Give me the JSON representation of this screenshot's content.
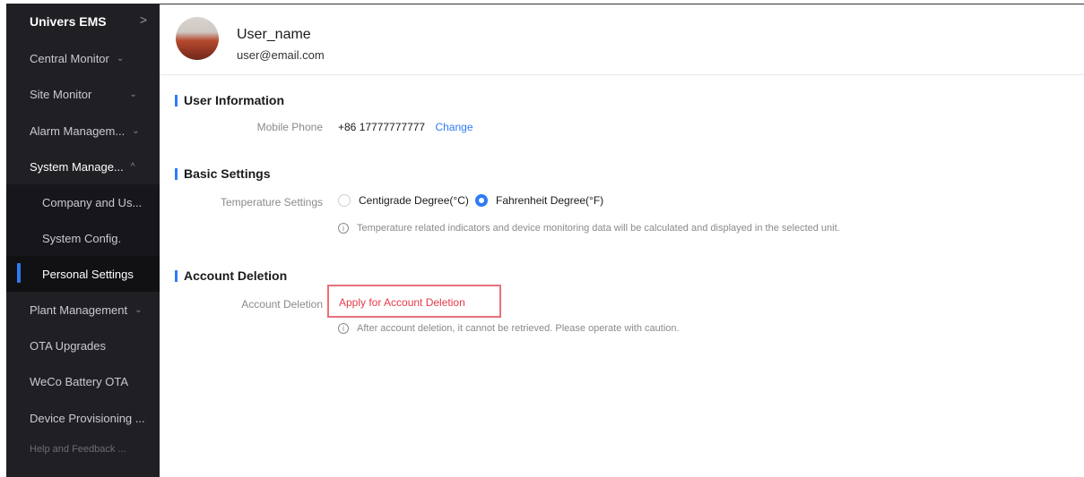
{
  "sidebar": {
    "brand": "Univers EMS",
    "items": [
      {
        "label": "Central Monitor",
        "chevron": "⌄"
      },
      {
        "label": "Site Monitor",
        "chevron": "⌄"
      },
      {
        "label": "Alarm Managem...",
        "chevron": "⌄"
      },
      {
        "label": "System Manage...",
        "chevron": "^"
      },
      {
        "label": "Company and Us..."
      },
      {
        "label": "System Config."
      },
      {
        "label": "Personal Settings"
      },
      {
        "label": "Plant Management",
        "chevron": "⌄"
      },
      {
        "label": "OTA Upgrades"
      },
      {
        "label": "WeCo Battery OTA"
      },
      {
        "label": "Device Provisioning ..."
      },
      {
        "label": "Help and Feedback ..."
      }
    ]
  },
  "user": {
    "name": "User_name",
    "email": "user@email.com"
  },
  "user_info": {
    "title": "User Information",
    "mobile_label": "Mobile Phone",
    "mobile_value": "+86 17777777777",
    "change_link": "Change"
  },
  "basic_settings": {
    "title": "Basic Settings",
    "temp_label": "Temperature Settings",
    "option_c": "Centigrade Degree(°C)",
    "option_f": "Fahrenheit Degree(°F)",
    "selected": "Fahrenheit Degree(°F)",
    "hint": "Temperature related indicators and device monitoring data will be calculated and displayed in the selected unit."
  },
  "account_deletion": {
    "title": "Account Deletion",
    "label": "Account Deletion",
    "button": "Apply for Account Deletion",
    "hint": "After account deletion, it cannot be retrieved. Please operate with caution."
  },
  "colors": {
    "accent": "#2f7bf5",
    "danger": "#e63b4b",
    "sidebar_bg": "#1f1f24"
  }
}
